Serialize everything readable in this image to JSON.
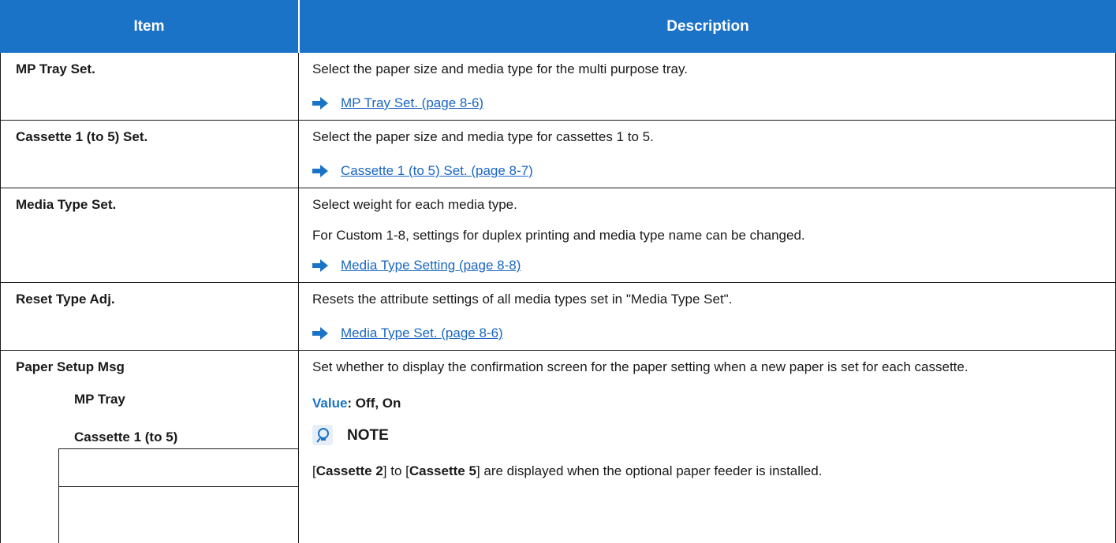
{
  "header": {
    "item": "Item",
    "description": "Description"
  },
  "rows": [
    {
      "item": "MP Tray Set.",
      "desc": "Select the paper size and media type for the multi purpose tray.",
      "link": "MP Tray Set. (page 8-6)"
    },
    {
      "item": "Cassette 1 (to 5) Set.",
      "desc": "Select the paper size and media type for cassettes 1 to 5.",
      "link": "Cassette 1 (to 5) Set. (page 8-7)"
    },
    {
      "item": "Media Type Set.",
      "desc": "Select weight for each media type.",
      "desc2": "For Custom 1-8, settings for duplex printing and media type name can be changed.",
      "link": "Media Type Setting (page 8-8)"
    },
    {
      "item": "Reset Type Adj.",
      "desc": "Resets the attribute settings of all media types set in \"Media Type Set\".",
      "link": "Media Type Set. (page 8-6)"
    },
    {
      "item": "Paper Setup Msg",
      "subitems": [
        "MP Tray",
        "Cassette 1 (to 5)"
      ],
      "desc": "Set whether to display the confirmation screen for the paper setting when a new paper is set for each cassette.",
      "value_label": "Value",
      "value_text": ": Off, On",
      "note_label": "NOTE",
      "note_open1": "[",
      "note_bold1": "Cassette 2",
      "note_mid": "] to [",
      "note_bold2": "Cassette 5",
      "note_rest": "] are displayed when the optional paper feeder is installed."
    }
  ],
  "colors": {
    "header_bg": "#1a73c6",
    "link": "#1a66c2",
    "arrow": "#1a73c6"
  },
  "icons": {
    "arrow": "arrow-right-icon",
    "note": "note-lightbulb-icon"
  }
}
